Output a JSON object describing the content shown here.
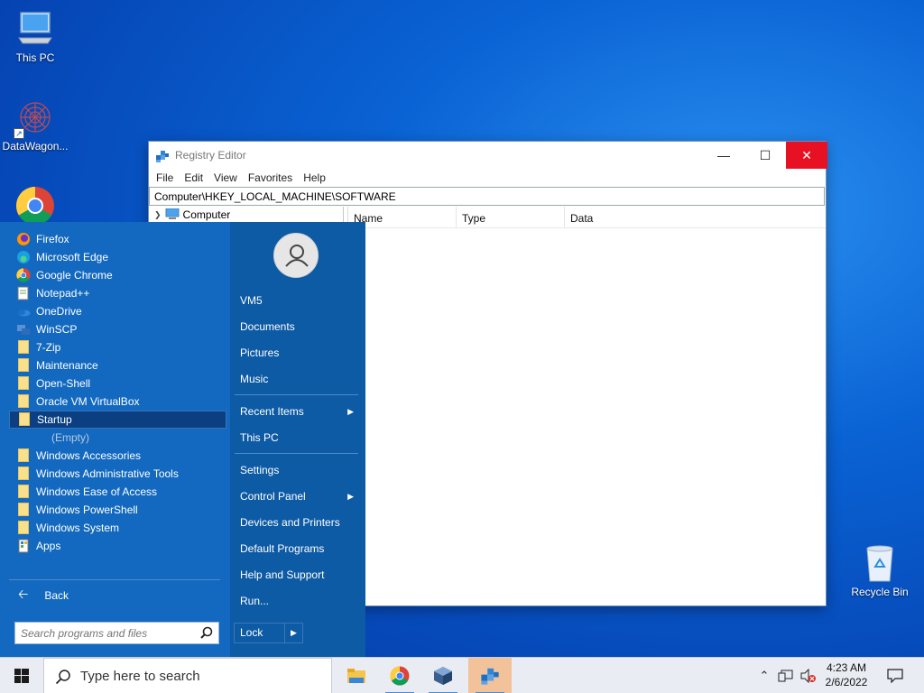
{
  "desktop": {
    "icons": [
      {
        "label": "This PC"
      },
      {
        "label": "DataWagon..."
      },
      {
        "label": ""
      },
      {
        "label": "Recycle Bin"
      }
    ]
  },
  "regedit": {
    "title": "Registry Editor",
    "menu": [
      "File",
      "Edit",
      "View",
      "Favorites",
      "Help"
    ],
    "address": "Computer\\HKEY_LOCAL_MACHINE\\SOFTWARE",
    "tree_root": "Computer",
    "columns": [
      "Name",
      "Type",
      "Data"
    ]
  },
  "startmenu": {
    "programs": [
      {
        "label": "Firefox",
        "icon": "firefox-icon"
      },
      {
        "label": "Microsoft Edge",
        "icon": "edge-icon"
      },
      {
        "label": "Google Chrome",
        "icon": "chrome-icon"
      },
      {
        "label": "Notepad++",
        "icon": "notepadpp-icon"
      },
      {
        "label": "OneDrive",
        "icon": "onedrive-icon"
      },
      {
        "label": "WinSCP",
        "icon": "winscp-icon"
      },
      {
        "label": "7-Zip",
        "icon": "folder-icon"
      },
      {
        "label": "Maintenance",
        "icon": "folder-icon"
      },
      {
        "label": "Open-Shell",
        "icon": "folder-icon"
      },
      {
        "label": "Oracle VM VirtualBox",
        "icon": "folder-icon"
      },
      {
        "label": "Startup",
        "icon": "folder-icon"
      },
      {
        "label": "(Empty)",
        "icon": ""
      },
      {
        "label": "Windows Accessories",
        "icon": "folder-icon"
      },
      {
        "label": "Windows Administrative Tools",
        "icon": "folder-icon"
      },
      {
        "label": "Windows Ease of Access",
        "icon": "folder-icon"
      },
      {
        "label": "Windows PowerShell",
        "icon": "folder-icon"
      },
      {
        "label": "Windows System",
        "icon": "folder-icon"
      },
      {
        "label": "Apps",
        "icon": "apps-icon"
      }
    ],
    "selected_program": "Startup",
    "back_label": "Back",
    "search_placeholder": "Search programs and files",
    "right": {
      "user": "VM5",
      "items1": [
        "Documents",
        "Pictures",
        "Music"
      ],
      "items2": [
        {
          "label": "Recent Items",
          "submenu": true
        },
        {
          "label": "This PC",
          "submenu": false
        }
      ],
      "items3": [
        {
          "label": "Settings",
          "submenu": false
        },
        {
          "label": "Control Panel",
          "submenu": true
        },
        {
          "label": "Devices and Printers",
          "submenu": false
        },
        {
          "label": "Default Programs",
          "submenu": false
        },
        {
          "label": "Help and Support",
          "submenu": false
        },
        {
          "label": "Run...",
          "submenu": false
        }
      ],
      "lock_label": "Lock"
    }
  },
  "taskbar": {
    "search_placeholder": "Type here to search",
    "apps": [
      "file-explorer-icon",
      "chrome-icon",
      "virtualbox-icon",
      "regedit-icon"
    ],
    "active_app": "regedit-icon",
    "time": "4:23 AM",
    "date": "2/6/2022"
  },
  "colors": {
    "desktop_bg": "#0a63d4",
    "startmenu_left": "#1369bf",
    "startmenu_right": "#0d5aa5",
    "close_button": "#e81123",
    "active_task": "#f2c39a"
  }
}
